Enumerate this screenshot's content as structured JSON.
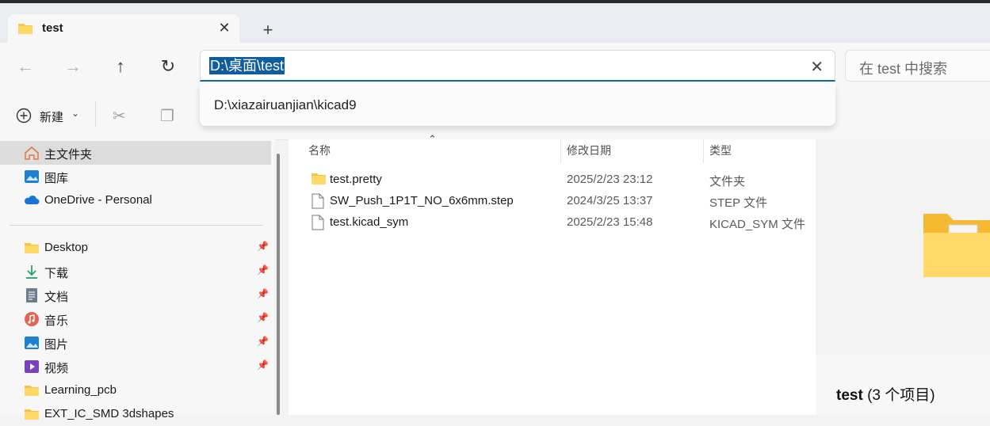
{
  "tab": {
    "title": "test",
    "close_glyph": "✕",
    "new_glyph": "+"
  },
  "nav": {
    "back_glyph": "←",
    "forward_glyph": "→",
    "up_glyph": "↑",
    "refresh_glyph": "↻"
  },
  "address": {
    "value": "D:\\桌面\\test",
    "clear_glyph": "✕"
  },
  "search": {
    "placeholder": "在 test 中搜索"
  },
  "suggestion": {
    "text": "D:\\xiazairuanjian\\kicad9"
  },
  "toolbar": {
    "new_label": "新建",
    "new_caret": "⌄",
    "cut_glyph": "✂",
    "copy_glyph": "❐"
  },
  "sidebar": {
    "items": [
      {
        "label": "主文件夹",
        "icon": "home-icon",
        "selected": true
      },
      {
        "label": "图库",
        "icon": "gallery-icon"
      },
      {
        "label": "OneDrive - Personal",
        "icon": "cloud-icon"
      },
      {
        "label": "Desktop",
        "icon": "folder-icon",
        "pinned": true
      },
      {
        "label": "下载",
        "icon": "download-icon",
        "pinned": true
      },
      {
        "label": "文档",
        "icon": "document-icon",
        "pinned": true
      },
      {
        "label": "音乐",
        "icon": "music-icon",
        "pinned": true
      },
      {
        "label": "图片",
        "icon": "pictures-icon",
        "pinned": true
      },
      {
        "label": "视频",
        "icon": "video-icon",
        "pinned": true
      },
      {
        "label": "Learning_pcb",
        "icon": "folder-icon"
      },
      {
        "label": "EXT_IC_SMD 3dshapes",
        "icon": "folder-icon"
      }
    ],
    "pin_glyph": "📌"
  },
  "files": {
    "columns": {
      "name": "名称",
      "modified": "修改日期",
      "type": "类型"
    },
    "sort_glyph": "⌃",
    "rows": [
      {
        "name": "test.pretty",
        "modified": "2025/2/23 23:12",
        "type": "文件夹",
        "icon": "folder-icon"
      },
      {
        "name": "SW_Push_1P1T_NO_6x6mm.step",
        "modified": "2024/3/25 13:37",
        "type": "STEP 文件",
        "icon": "file-icon"
      },
      {
        "name": "test.kicad_sym",
        "modified": "2025/2/23 15:48",
        "type": "KICAD_SYM 文件",
        "icon": "file-icon"
      }
    ]
  },
  "details": {
    "name": "test",
    "count": "(3 个项目)"
  },
  "colors": {
    "accent": "#0f5d9c",
    "folder": "#f6c343",
    "selected": "#dcdcdc"
  }
}
